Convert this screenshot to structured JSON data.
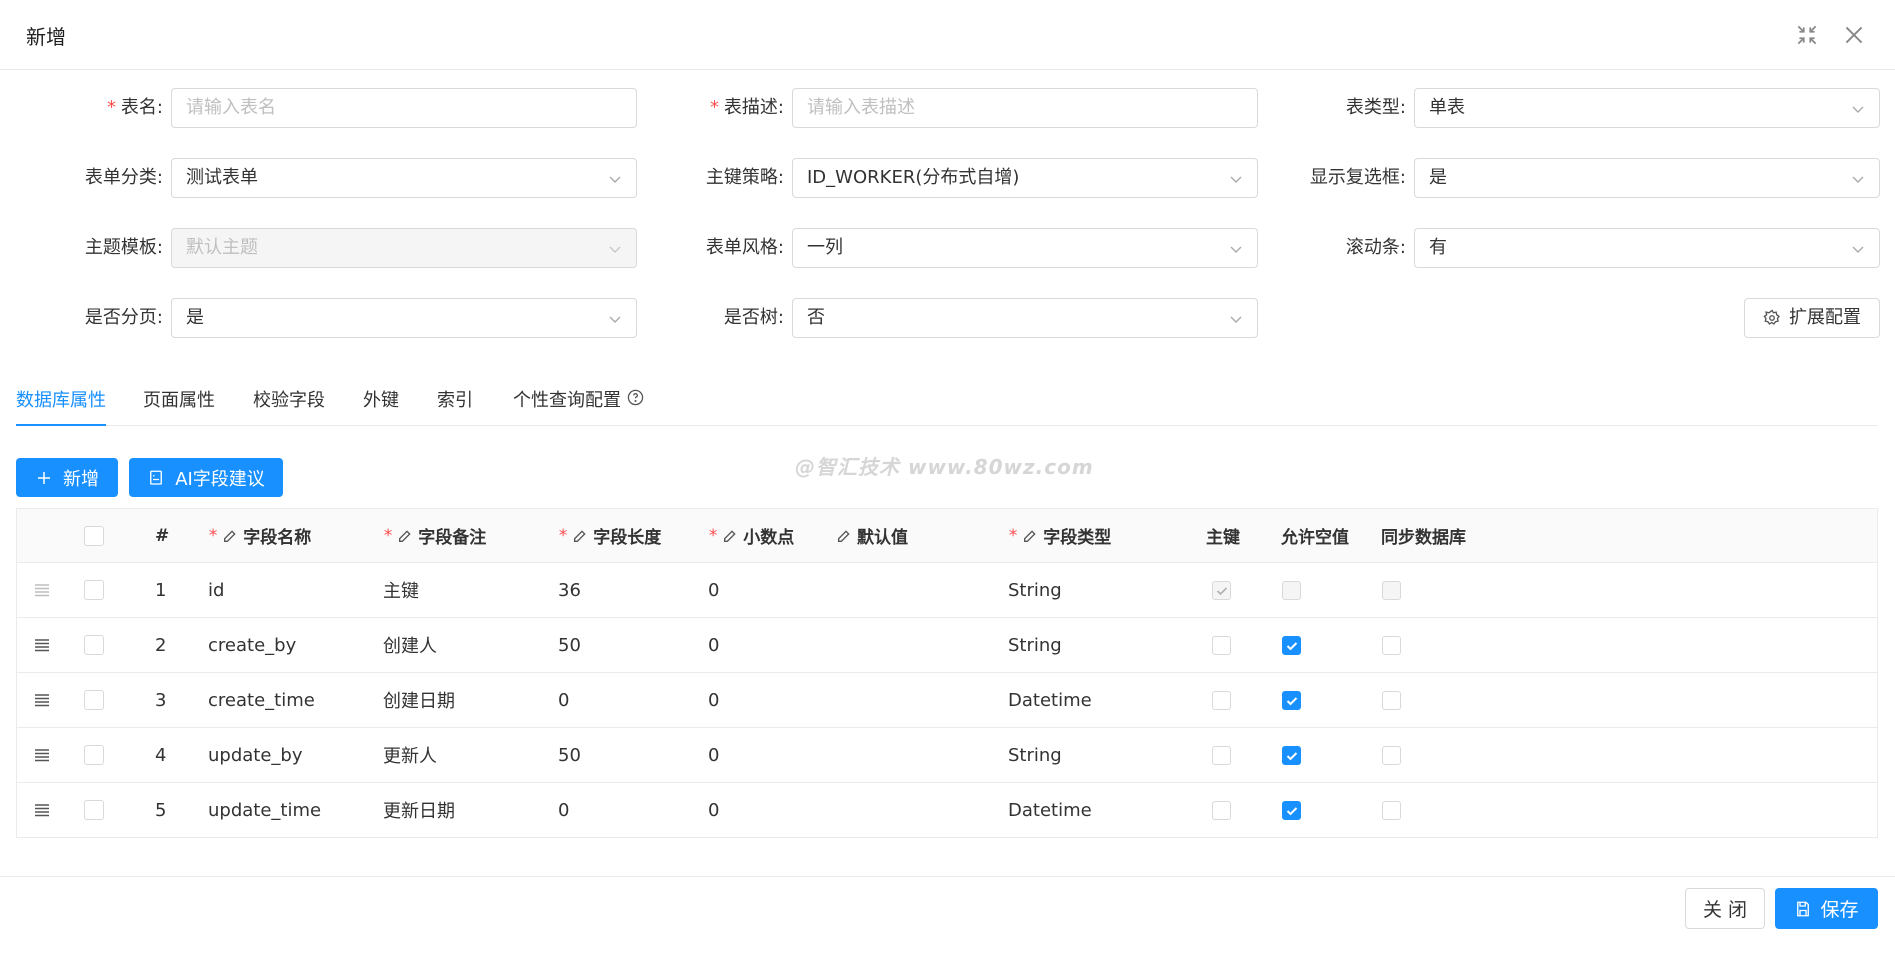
{
  "modal": {
    "title": "新增"
  },
  "form": {
    "table_name": {
      "label": "表名",
      "required": "*",
      "placeholder": "请输入表名"
    },
    "table_desc": {
      "label": "表描述",
      "required": "*",
      "placeholder": "请输入表描述"
    },
    "table_type": {
      "label": "表类型",
      "value": "单表"
    },
    "form_category": {
      "label": "表单分类",
      "value": "测试表单"
    },
    "pk_strategy": {
      "label": "主键策略",
      "value": "ID_WORKER(分布式自增)"
    },
    "show_checkbox": {
      "label": "显示复选框",
      "value": "是"
    },
    "theme_template": {
      "label": "主题模板",
      "value": "默认主题"
    },
    "form_style": {
      "label": "表单风格",
      "value": "一列"
    },
    "scrollbar": {
      "label": "滚动条",
      "value": "有"
    },
    "paging": {
      "label": "是否分页",
      "value": "是"
    },
    "is_tree": {
      "label": "是否树",
      "value": "否"
    },
    "ext_config_label": "扩展配置"
  },
  "tabs": [
    "数据库属性",
    "页面属性",
    "校验字段",
    "外键",
    "索引",
    "个性查询配置"
  ],
  "toolbar": {
    "add_label": "新增",
    "ai_label": "AI字段建议"
  },
  "watermark": "@智汇技术 www.80wz.com",
  "table": {
    "required_mark": "*",
    "headers": {
      "index": "#",
      "field_name": "字段名称",
      "field_remark": "字段备注",
      "field_length": "字段长度",
      "decimal": "小数点",
      "default_value": "默认值",
      "field_type": "字段类型",
      "primary_key": "主键",
      "nullable": "允许空值",
      "sync_db": "同步数据库"
    },
    "rows": [
      {
        "index": "1",
        "field_name": "id",
        "field_remark": "主键",
        "field_length": "36",
        "decimal": "0",
        "default_value": "",
        "field_type": "String",
        "pk": "checked-disabled",
        "nullable": "disabled",
        "sync": "disabled"
      },
      {
        "index": "2",
        "field_name": "create_by",
        "field_remark": "创建人",
        "field_length": "50",
        "decimal": "0",
        "default_value": "",
        "field_type": "String",
        "pk": "unchecked",
        "nullable": "checked",
        "sync": "unchecked"
      },
      {
        "index": "3",
        "field_name": "create_time",
        "field_remark": "创建日期",
        "field_length": "0",
        "decimal": "0",
        "default_value": "",
        "field_type": "Datetime",
        "pk": "unchecked",
        "nullable": "checked",
        "sync": "unchecked"
      },
      {
        "index": "4",
        "field_name": "update_by",
        "field_remark": "更新人",
        "field_length": "50",
        "decimal": "0",
        "default_value": "",
        "field_type": "String",
        "pk": "unchecked",
        "nullable": "checked",
        "sync": "unchecked"
      },
      {
        "index": "5",
        "field_name": "update_time",
        "field_remark": "更新日期",
        "field_length": "0",
        "decimal": "0",
        "default_value": "",
        "field_type": "Datetime",
        "pk": "unchecked",
        "nullable": "checked",
        "sync": "unchecked"
      }
    ]
  },
  "footer": {
    "close_label": "关 闭",
    "save_label": "保存"
  },
  "colors": {
    "primary": "#1890ff",
    "required": "#ff4d4f",
    "border": "#d9d9d9"
  }
}
